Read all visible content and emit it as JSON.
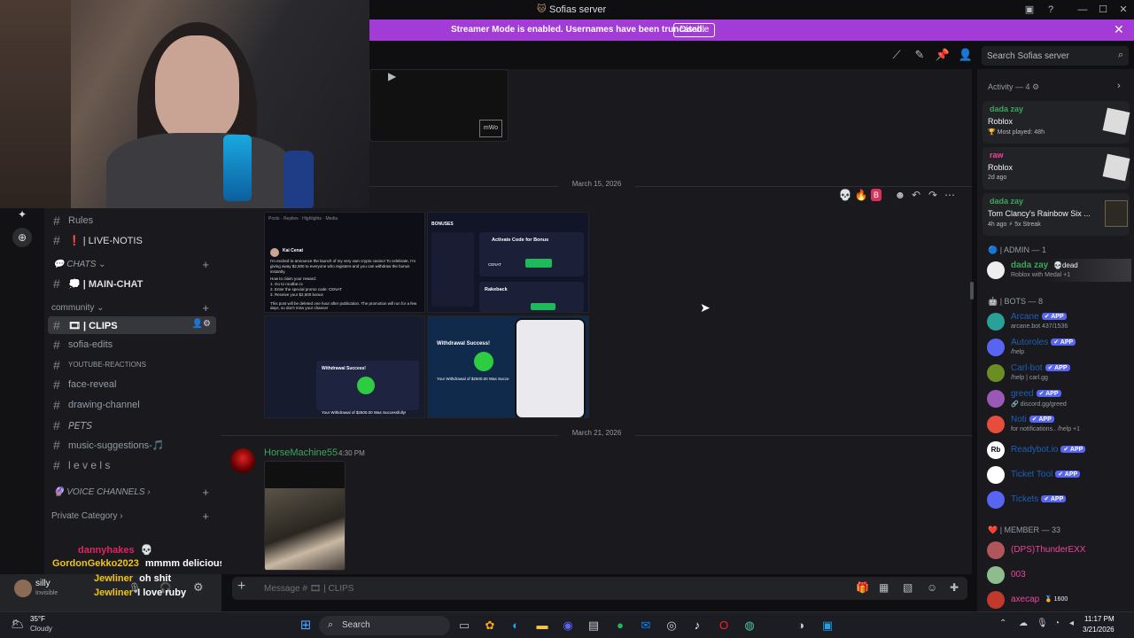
{
  "window": {
    "title": "Sofias server"
  },
  "banner": {
    "message": "Streamer Mode is enabled. Usernames have been truncated.",
    "disable_label": "Disable"
  },
  "search": {
    "placeholder": "Search Sofias server"
  },
  "channels": {
    "items_top": [
      {
        "label": "Rules"
      },
      {
        "label": "❗ | LIVE-NOTIS"
      }
    ],
    "chats_category": "💬 CHATS ⌄",
    "main_chat": "💭 | MAIN-CHAT",
    "community_category": "community ⌄",
    "clips": "🎞 | CLIPS",
    "community_items": [
      {
        "label": "sofia-edits"
      },
      {
        "label": "YOUTUBE-REACTIONS"
      },
      {
        "label": "face-reveal"
      },
      {
        "label": "drawing-channel"
      },
      {
        "label": "𝘗𝘌𝘛𝘚"
      },
      {
        "label": "music-suggestions-🎵"
      },
      {
        "label": "l e v e l s"
      }
    ],
    "voice_category": "🔮 VOICE CHANNELS ›",
    "private_category": "Private Category ›"
  },
  "stream_chat": [
    {
      "user": "dannyhakes",
      "text": "💀",
      "color": "#e0245e"
    },
    {
      "user": "GordonGekko2023",
      "text": "mmmm delicious",
      "color": "#f0c419"
    },
    {
      "user": "Jewliner",
      "text": "oh shit",
      "color": "#f0c419"
    },
    {
      "user": "Jewliner",
      "text": "I love ruby",
      "color": "#f0c419"
    }
  ],
  "user_panel": {
    "name": "silly",
    "status": "Invisible"
  },
  "messages": {
    "date1": "March 15, 2026",
    "date2": "March 21, 2026",
    "author": "HorseMachine55",
    "time": "4:30 PM",
    "collage": {
      "tweet_author": "Kai Cenat",
      "tweet_text": "I'm excited to announce the launch of my very own crypto casino! To celebrate, I'm giving away $2,500 to everyone who registers-and you can withdraw the bonus instantly.",
      "tweet_steps": [
        "How to claim your reward:",
        "1. Go to roodbe.cc",
        "2. Enter the special promo code: CENAT",
        "3. Receive your $2,500 bonus"
      ],
      "tweet_footer": "This post will be deleted one hour after publication. The promotion will run for a few days, so don't miss your chance!",
      "bonuses_title": "BONUSES",
      "activate_title": "Activate Code for Bonus",
      "promo_code": "CENAT",
      "rakeback": "Rakeback",
      "withdrawal_success": "Withdrawal Success!",
      "withdrawal_text": "Your Withdrawal of $2500.00 Was Successfully!",
      "withdrawal_text2": "Your Withdrawal of $2500.00 Was Succe"
    }
  },
  "composer": {
    "placeholder": "Message # 🎞 | CLIPS"
  },
  "members": {
    "activity_header": "Activity — 4 ⚙",
    "activity": [
      {
        "user": "dada zay",
        "game": "Roblox",
        "sub": "🏆 Most played: 48h",
        "color": "#3ba55d"
      },
      {
        "user": "raw",
        "game": "Roblox",
        "sub": "2d ago",
        "color": "#eb459e"
      },
      {
        "user": "dada zay",
        "game": "Tom Clancy's Rainbow Six ...",
        "sub": "4h ago  ⚡ 5x Streak",
        "color": "#3ba55d"
      }
    ],
    "admin_header": "🔵 | ADMIN — 1",
    "admin": {
      "user": "dada zay",
      "tag": "💀dead",
      "sub": "Roblox with Medal +1"
    },
    "bots_header": "🤖 | BOTS — 8",
    "bots": [
      {
        "name": "Arcane",
        "sub": "arcane.bot 437/1536",
        "color": "#1d5fb8",
        "av": "#2aa198"
      },
      {
        "name": "Autoroles",
        "sub": "/help",
        "color": "#1d5fb8",
        "av": "#5865f2"
      },
      {
        "name": "Carl-bot",
        "sub": "/help | carl.gg",
        "color": "#1d5fb8",
        "av": "#6b8e23"
      },
      {
        "name": "greed",
        "sub": "🔗 discord.gg/greed",
        "color": "#1d5fb8",
        "av": "#9b59b6"
      },
      {
        "name": "Noti",
        "sub": "for notifications.. /help +1",
        "color": "#1d5fb8",
        "av": "#e74c3c"
      },
      {
        "name": "Readybot.io",
        "sub": "",
        "color": "#1d5fb8",
        "av": "#ffffff"
      },
      {
        "name": "Ticket Tool",
        "sub": "",
        "color": "#1d5fb8",
        "av": "#ffffff"
      },
      {
        "name": "Tickets",
        "sub": "",
        "color": "#1d5fb8",
        "av": "#5865f2"
      }
    ],
    "app_badge": "✔ APP",
    "member_header": "❤️ | MEMBER — 33",
    "member_list": [
      {
        "name": "(DPS)ThunderEXX",
        "color": "#eb459e"
      },
      {
        "name": "003",
        "color": "#eb459e"
      },
      {
        "name": "axecap",
        "tag": "🏅 1600",
        "color": "#eb459e"
      }
    ]
  },
  "taskbar": {
    "weather_temp": "35°F",
    "weather_desc": "Cloudy",
    "search_label": "Search",
    "time": "11:17 PM",
    "date": "3/21/2026"
  }
}
